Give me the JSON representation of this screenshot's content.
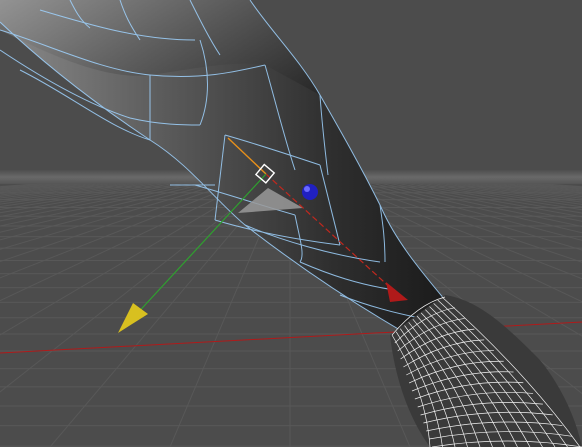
{
  "viewport": {
    "name": "3d-perspective-viewport"
  },
  "colors": {
    "background": "#4e4e4e",
    "grid_line": "#5a5a5a",
    "horizon_band": "#6a6a6a",
    "x_axis_world": "#b01a1a",
    "wireframe_edge": "#9fd3ff",
    "hand_wire": "#ffffff",
    "axis_x": "#c0281e",
    "axis_y_green": "#2fa02f",
    "axis_y_handle": "#d8c020",
    "axis_z_orange": "#e8901a",
    "rotate_handle": "#2020c0",
    "selection_box": "#ffffff",
    "plane_handle": "#9a9a9a"
  },
  "objects": {
    "mesh": "forearm-mesh",
    "hand": "hand-wireframe-mesh",
    "gizmo": "move-transform-gizmo"
  }
}
